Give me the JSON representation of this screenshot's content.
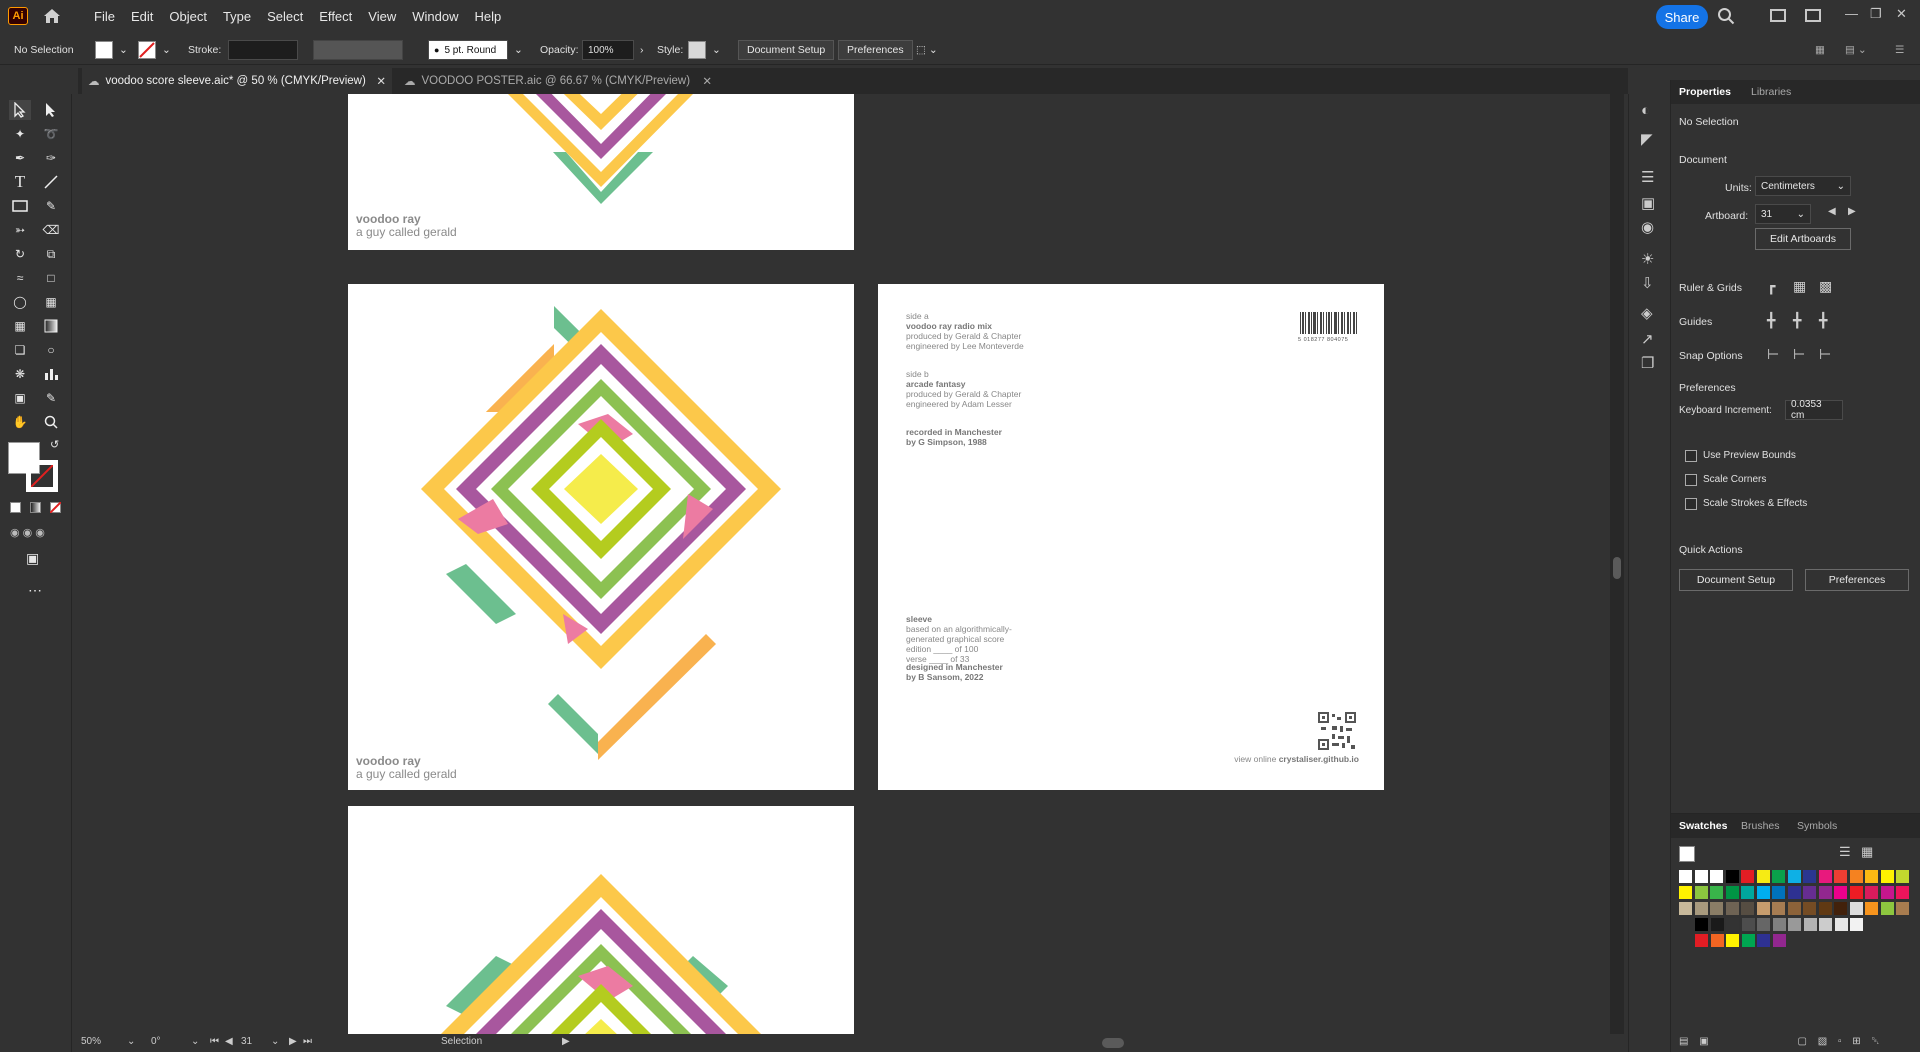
{
  "app": {
    "icon_text": "Ai"
  },
  "menu": [
    "File",
    "Edit",
    "Object",
    "Type",
    "Select",
    "Effect",
    "View",
    "Window",
    "Help"
  ],
  "share_label": "Share",
  "control_bar": {
    "selection": "No Selection",
    "stroke_label": "Stroke:",
    "brush": "5 pt. Round",
    "opacity_label": "Opacity:",
    "opacity_value": "100%",
    "style_label": "Style:",
    "document_setup": "Document Setup",
    "preferences": "Preferences"
  },
  "tabs": [
    {
      "label": "voodoo score sleeve.aic* @ 50 % (CMYK/Preview)",
      "active": true
    },
    {
      "label": "VOODOO POSTER.aic @ 66.67 % (CMYK/Preview)",
      "active": false
    }
  ],
  "artwork": {
    "title": "voodoo ray",
    "subtitle": "a guy called gerald"
  },
  "back_cover": {
    "side_a_heading": "side a",
    "side_a_track": "voodoo ray radio mix",
    "side_a_producer": "produced by Gerald & Chapter",
    "side_a_engineer": "engineered by Lee Monteverde",
    "side_b_heading": "side b",
    "side_b_track": "arcade fantasy",
    "side_b_producer": "produced by Gerald & Chapter",
    "side_b_engineer": "engineered by Adam Lesser",
    "recorded_line1": "recorded in Manchester",
    "recorded_line2": "by G Simpson, 1988",
    "barcode_digits": "5 018277 804075",
    "sleeve_heading": "sleeve",
    "sleeve_line1": "based on an algorithmically-",
    "sleeve_line2": "generated graphical score",
    "sleeve_line3": "edition ____ of 100",
    "sleeve_line4": "verse ____ of 33",
    "designed_line1": "designed in Manchester",
    "designed_line2": "by B Sansom, 2022",
    "view_online_prefix": "view online",
    "view_online_url": "crystaliser.github.io"
  },
  "properties": {
    "tab_properties": "Properties",
    "tab_libraries": "Libraries",
    "selection": "No Selection",
    "document_heading": "Document",
    "units_label": "Units:",
    "units_value": "Centimeters",
    "artboard_label": "Artboard:",
    "artboard_value": "31",
    "edit_artboards": "Edit Artboards",
    "ruler_grids": "Ruler & Grids",
    "guides": "Guides",
    "snap_options": "Snap Options",
    "preferences_heading": "Preferences",
    "keyboard_increment_label": "Keyboard Increment:",
    "keyboard_increment_value": "0.0353 cm",
    "use_preview_bounds": "Use Preview Bounds",
    "scale_corners": "Scale Corners",
    "scale_strokes": "Scale Strokes & Effects",
    "quick_actions": "Quick Actions",
    "document_setup_btn": "Document Setup",
    "preferences_btn": "Preferences"
  },
  "swatches_panel": {
    "tab_swatches": "Swatches",
    "tab_brushes": "Brushes",
    "tab_symbols": "Symbols"
  },
  "status": {
    "zoom": "50%",
    "rotation": "0°",
    "artboard_num": "31",
    "tool": "Selection"
  },
  "colors": {
    "accent": "#1473e6",
    "yellow": "#fcc84a",
    "purple": "#a8579e",
    "green": "#6cbf8f",
    "lime": "#b4cc1f",
    "light_yellow": "#f5ec4b",
    "pink": "#ec7ba2",
    "orange": "#f9b24f",
    "olive_green": "#8cc152"
  }
}
